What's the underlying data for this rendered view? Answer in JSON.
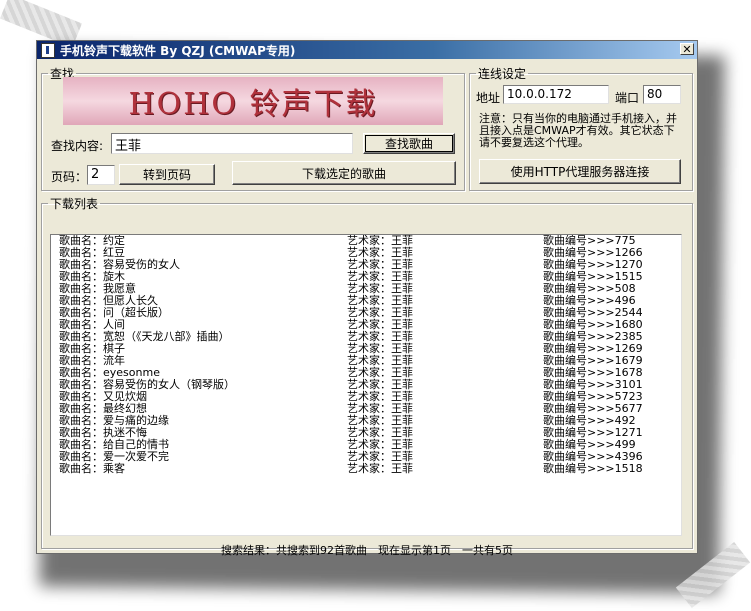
{
  "window": {
    "title": "手机铃声下载软件 By QZJ (CMWAP专用)",
    "close_glyph": "✕"
  },
  "search": {
    "group_title": "查找",
    "banner_text": "HOHO 铃声下载",
    "query_label": "查找内容:",
    "query_value": "王菲",
    "search_button": "查找歌曲",
    "page_label": "页码：",
    "page_value": "2",
    "goto_button": "转到页码",
    "download_button": "下载选定的歌曲"
  },
  "connection": {
    "group_title": "连线设定",
    "address_label": "地址",
    "address_value": "10.0.0.172",
    "port_label": "端口",
    "port_value": "80",
    "note_lines": [
      "注意：只有当你的电脑通过手机接入，并",
      "且接入点是CMWAP才有效。其它状态下",
      "请不要复选这个代理。"
    ],
    "proxy_button": "使用HTTP代理服务器连接"
  },
  "download_list": {
    "group_title": "下载列表",
    "rows": [
      {
        "song": "歌曲名：约定",
        "artist": "艺术家：王菲",
        "id": "歌曲编号>>>775"
      },
      {
        "song": "歌曲名：红豆",
        "artist": "艺术家：王菲",
        "id": "歌曲编号>>>1266"
      },
      {
        "song": "歌曲名：容易受伤的女人",
        "artist": "艺术家：王菲",
        "id": "歌曲编号>>>1270"
      },
      {
        "song": "歌曲名：旋木",
        "artist": "艺术家：王菲",
        "id": "歌曲编号>>>1515"
      },
      {
        "song": "歌曲名：我愿意",
        "artist": "艺术家：王菲",
        "id": "歌曲编号>>>508"
      },
      {
        "song": "歌曲名：但愿人长久",
        "artist": "艺术家：王菲",
        "id": "歌曲编号>>>496"
      },
      {
        "song": "歌曲名：问（超长版）",
        "artist": "艺术家：王菲",
        "id": "歌曲编号>>>2544"
      },
      {
        "song": "歌曲名：人间",
        "artist": "艺术家：王菲",
        "id": "歌曲编号>>>1680"
      },
      {
        "song": "歌曲名：宽恕（《天龙八部》插曲）",
        "artist": "艺术家：王菲",
        "id": "歌曲编号>>>2385"
      },
      {
        "song": "歌曲名：棋子",
        "artist": "艺术家：王菲",
        "id": "歌曲编号>>>1269"
      },
      {
        "song": "歌曲名：流年",
        "artist": "艺术家：王菲",
        "id": "歌曲编号>>>1679"
      },
      {
        "song": "歌曲名：eyesonme",
        "artist": "艺术家：王菲",
        "id": "歌曲编号>>>1678"
      },
      {
        "song": "歌曲名：容易受伤的女人（钢琴版）",
        "artist": "艺术家：王菲",
        "id": "歌曲编号>>>3101"
      },
      {
        "song": "歌曲名：又见炊烟",
        "artist": "艺术家：王菲",
        "id": "歌曲编号>>>5723"
      },
      {
        "song": "歌曲名：最终幻想",
        "artist": "艺术家：王菲",
        "id": "歌曲编号>>>5677"
      },
      {
        "song": "歌曲名：爱与痛的边缘",
        "artist": "艺术家：王菲",
        "id": "歌曲编号>>>492"
      },
      {
        "song": "歌曲名：执迷不悔",
        "artist": "艺术家：王菲",
        "id": "歌曲编号>>>1271"
      },
      {
        "song": "歌曲名：给自己的情书",
        "artist": "艺术家：王菲",
        "id": "歌曲编号>>>499"
      },
      {
        "song": "歌曲名：爱一次爱不完",
        "artist": "艺术家：王菲",
        "id": "歌曲编号>>>4396"
      },
      {
        "song": "歌曲名：乘客",
        "artist": "艺术家：王菲",
        "id": "歌曲编号>>>1518"
      }
    ],
    "status_text": "搜索结果：共搜索到92首歌曲　现在显示第1页　一共有5页"
  }
}
